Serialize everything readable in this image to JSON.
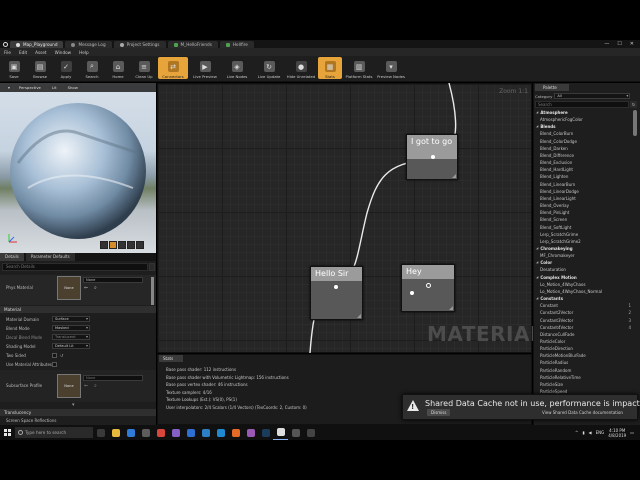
{
  "tabs": [
    {
      "label": "Map_Playground",
      "icon": "ue-logo-icon",
      "active": true
    },
    {
      "label": "Message Log",
      "icon": "log-icon",
      "active": false
    },
    {
      "label": "Project Settings",
      "icon": "gear-icon",
      "active": false
    },
    {
      "label": "M_HelloFriends",
      "icon": "material-icon",
      "active": false
    },
    {
      "label": "Hellfire",
      "icon": "material-icon",
      "active": false
    }
  ],
  "window_controls": {
    "minimize": "—",
    "maximize": "☐",
    "close": "✕"
  },
  "menu": [
    "File",
    "Edit",
    "Asset",
    "Window",
    "Help"
  ],
  "toolbar": [
    {
      "label": "Save",
      "icon": "save-icon",
      "hl": false
    },
    {
      "label": "Browse",
      "icon": "browse-icon",
      "hl": false
    },
    {
      "label": "Apply",
      "icon": "apply-icon",
      "hl": false
    },
    {
      "label": "Search",
      "icon": "search-icon",
      "hl": false
    },
    {
      "label": "Home",
      "icon": "home-icon",
      "hl": false
    },
    {
      "label": "Clean Up",
      "icon": "clean-up-icon",
      "hl": false
    },
    {
      "label": "Connectors",
      "icon": "connectors-icon",
      "hl": true
    },
    {
      "label": "Live Preview",
      "icon": "live-preview-icon",
      "hl": false
    },
    {
      "label": "Live Nodes",
      "icon": "live-nodes-icon",
      "hl": false
    },
    {
      "label": "Live Update",
      "icon": "live-update-icon",
      "hl": false
    },
    {
      "label": "Hide Unrelated",
      "icon": "hide-unrelated-icon",
      "hl": false
    },
    {
      "label": "Stats",
      "icon": "stats-icon",
      "hl": true
    },
    {
      "label": "Platform Stats",
      "icon": "platform-stats-icon",
      "hl": false
    },
    {
      "label": "Preview Nodes",
      "icon": "preview-nodes-icon",
      "hl": false
    }
  ],
  "viewport": {
    "buttons": [
      "Perspective",
      "Lit",
      "Show"
    ]
  },
  "details": {
    "tabs": [
      "Details",
      "Parameter Defaults"
    ],
    "search_placeholder": "Search Details",
    "phys_material_label": "Phys Material",
    "none_label": "None",
    "material_section": "Material",
    "props": [
      {
        "label": "Material Domain",
        "value": "Surface"
      },
      {
        "label": "Blend Mode",
        "value": "Masked"
      },
      {
        "label": "Decal Blend Mode",
        "value": "Translucent"
      },
      {
        "label": "Shading Model",
        "value": "Default Lit"
      }
    ],
    "two_sided": "Two Sided",
    "use_attrs": "Use Material Attributes",
    "subsurface": "Subsurface Profile",
    "translucency": "Translucency",
    "ssr": "Screen Space Reflections"
  },
  "graph": {
    "zoom": "Zoom 1:1",
    "watermark": "MATERIAL",
    "nodes": [
      {
        "title": "I got to go"
      },
      {
        "title": "Hello Sir"
      },
      {
        "title": "Hey"
      }
    ]
  },
  "stats": {
    "tab": "Stats",
    "lines": [
      "Base pass shader: 112 instructions",
      "Base pass shader with Volumetric Lightmap: 156 instructions",
      "Base pass vertex shader: 46 instructions",
      "Texture samplers: 4/16",
      "Texture Lookups (Est.): VS(0), PS(1)",
      "User interpolators: 2/4 Scalars (1/4 Vectors) (TexCoords: 2, Custom: 0)"
    ]
  },
  "palette": {
    "tab": "Palette",
    "category_label": "Category",
    "category_value": "All",
    "search_placeholder": "Search",
    "items": [
      {
        "text": "Atmosphere",
        "cat": true
      },
      {
        "text": "AtmosphericFogColor"
      },
      {
        "text": "Blends",
        "cat": true
      },
      {
        "text": "Blend_ColorBurn"
      },
      {
        "text": "Blend_ColorDodge"
      },
      {
        "text": "Blend_Darken"
      },
      {
        "text": "Blend_Difference"
      },
      {
        "text": "Blend_Exclusion"
      },
      {
        "text": "Blend_HardLight"
      },
      {
        "text": "Blend_Lighten"
      },
      {
        "text": "Blend_LinearBurn"
      },
      {
        "text": "Blend_LinearDodge"
      },
      {
        "text": "Blend_LinearLight"
      },
      {
        "text": "Blend_Overlay"
      },
      {
        "text": "Blend_PinLight"
      },
      {
        "text": "Blend_Screen"
      },
      {
        "text": "Blend_SoftLight"
      },
      {
        "text": "Lerp_ScratchGrime"
      },
      {
        "text": "Lerp_ScratchGrime2"
      },
      {
        "text": "Chromakeying",
        "cat": true
      },
      {
        "text": "MF_Chromakeyer"
      },
      {
        "text": "Color",
        "cat": true
      },
      {
        "text": "Desaturation"
      },
      {
        "text": "Complex Motion",
        "cat": true
      },
      {
        "text": "Lo_Motion_4WayChaos"
      },
      {
        "text": "Lo_Motion_4WayChaos_Normal"
      },
      {
        "text": "Constants",
        "cat": true
      },
      {
        "text": "Constant",
        "hk": "1"
      },
      {
        "text": "Constant2Vector",
        "hk": "2"
      },
      {
        "text": "Constant3Vector",
        "hk": "3"
      },
      {
        "text": "Constant4Vector",
        "hk": "4"
      },
      {
        "text": "DistanceCullFade"
      },
      {
        "text": "ParticleColor"
      },
      {
        "text": "ParticleDirection"
      },
      {
        "text": "ParticleMotionBlurFade"
      },
      {
        "text": "ParticleRadius"
      },
      {
        "text": "ParticleRandom"
      },
      {
        "text": "ParticleRelativeTime"
      },
      {
        "text": "ParticleSize"
      },
      {
        "text": "ParticleSpeed"
      }
    ]
  },
  "toast": {
    "message": "Shared Data Cache not in use, performance is impacted.",
    "dismiss": "Dismiss",
    "link": "View Shared Data Cache documentation"
  },
  "taskbar": {
    "search_placeholder": "Type here to search",
    "apps": [
      {
        "name": "task-view-icon",
        "color": "#3a3a3a"
      },
      {
        "name": "explorer-icon",
        "color": "#e7b83c"
      },
      {
        "name": "edge-icon",
        "color": "#2f7bd9"
      },
      {
        "name": "store-icon",
        "color": "#5d5d5d"
      },
      {
        "name": "chrome-icon",
        "color": "#d9463b"
      },
      {
        "name": "visual-studio-icon",
        "color": "#865fc5"
      },
      {
        "name": "mail-icon",
        "color": "#2d6fd3"
      },
      {
        "name": "photos-icon",
        "color": "#2c7fc4"
      },
      {
        "name": "vs-code-icon",
        "color": "#1f8ad2"
      },
      {
        "name": "firefox-icon",
        "color": "#e36b25"
      },
      {
        "name": "app-icon",
        "color": "#9b59b6"
      },
      {
        "name": "steam-icon",
        "color": "#1b3b5a"
      },
      {
        "name": "unreal-icon",
        "color": "#dddddd",
        "active": true
      },
      {
        "name": "app2-icon",
        "color": "#555555"
      },
      {
        "name": "epic-icon",
        "color": "#444444"
      }
    ],
    "lang": "ENG",
    "time": "4:10 PM",
    "date": "4/8/2019"
  }
}
